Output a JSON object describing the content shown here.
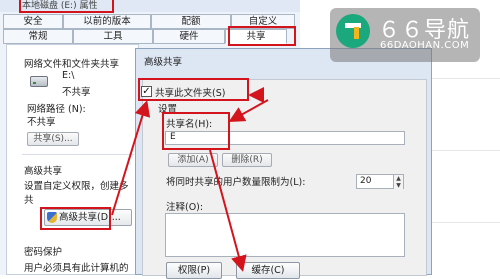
{
  "colors": {
    "annotation": "#d4141c",
    "dialog_bg": "#dde7f3",
    "watermark_green": "#1aa87c"
  },
  "properties_window": {
    "title": "本地磁盘 (E:) 属性",
    "tabs_row1": [
      "安全",
      "以前的版本",
      "配额",
      "自定义"
    ],
    "tabs_row2": [
      "常规",
      "工具",
      "硬件",
      "共享"
    ],
    "network_section_title": "网络文件和文件夹共享",
    "drive_label": "E:\\",
    "drive_status": "不共享",
    "network_path_label": "网络路径 (N):",
    "network_path_value": "不共享",
    "share_button": "共享(S)...",
    "advanced_section_title": "高级共享",
    "advanced_desc_line1": "设置自定义权限，创建多",
    "advanced_desc_line2": "共",
    "advanced_share_button": "高级共享(D)...",
    "password_section_title": "密码保护",
    "password_desc": "用户必须具有此计算机的"
  },
  "advanced_dialog": {
    "title": "高级共享",
    "share_checkbox_label": "共享此文件夹(S)",
    "share_checked": true,
    "settings_label": "设置",
    "share_name_label": "共享名(H):",
    "share_name_value": "E",
    "add_button": "添加(A)",
    "remove_button": "删除(R)",
    "user_limit_label": "将同时共享的用户数量限制为(L):",
    "user_limit_value": "20",
    "comment_label": "注释(O):",
    "permissions_button": "权限(P)",
    "caching_button": "缓存(C)"
  },
  "watermark": {
    "name": "６６导航",
    "domain": "66DAOHAN.COM"
  }
}
